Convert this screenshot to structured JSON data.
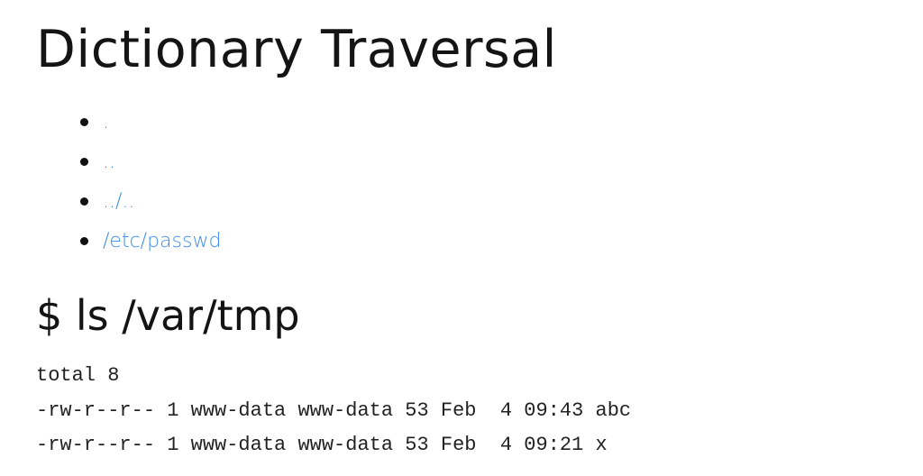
{
  "page": {
    "title": "Dictionary Traversal",
    "links": [
      {
        "label": "."
      },
      {
        "label": ".."
      },
      {
        "label": "../.."
      },
      {
        "label": "/etc/passwd"
      }
    ],
    "command_heading": "$ ls /var/tmp",
    "listing": [
      "total 8",
      "-rw-r--r-- 1 www-data www-data 53 Feb  4 09:43 abc",
      "-rw-r--r-- 1 www-data www-data 53 Feb  4 09:21 x"
    ]
  },
  "colors": {
    "link": "#3c8cf0",
    "text": "#141414",
    "background": "#ffffff"
  }
}
